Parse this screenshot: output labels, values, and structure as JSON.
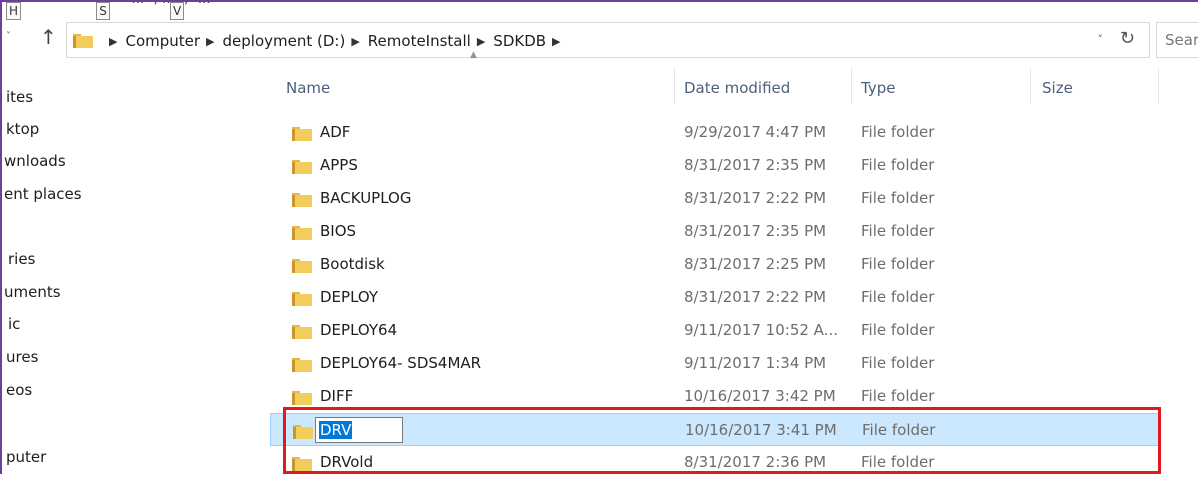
{
  "colors": {
    "frame": "#6b3fa0",
    "selection": "#cce8ff",
    "annotation": "#e0191c",
    "folder": "#dcb23f"
  },
  "ribbon": {
    "partial_text": "‹ … ›, … ›, ›…",
    "keytips": [
      "H",
      "S",
      "V"
    ]
  },
  "address_bar": {
    "back_glyph": "˅",
    "up_glyph": "↑",
    "crumbs": [
      "Computer",
      "deployment (D:)",
      "RemoteInstall",
      "SDKDB"
    ],
    "dropdown_glyph": "˅",
    "refresh_glyph": "↻"
  },
  "search": {
    "placeholder": "Searc"
  },
  "sidebar": {
    "items": [
      "ites",
      "ktop",
      "wnloads",
      "ent places",
      "ries",
      "uments",
      "ic",
      "ures",
      "eos",
      "puter"
    ]
  },
  "columns": {
    "name": "Name",
    "date_modified": "Date modified",
    "type": "Type",
    "size": "Size"
  },
  "rows": [
    {
      "name": "ADF",
      "date": "9/29/2017 4:47 PM",
      "type": "File folder"
    },
    {
      "name": "APPS",
      "date": "8/31/2017 2:35 PM",
      "type": "File folder"
    },
    {
      "name": "BACKUPLOG",
      "date": "8/31/2017 2:22 PM",
      "type": "File folder"
    },
    {
      "name": "BIOS",
      "date": "8/31/2017 2:35 PM",
      "type": "File folder"
    },
    {
      "name": "Bootdisk",
      "date": "8/31/2017 2:25 PM",
      "type": "File folder"
    },
    {
      "name": "DEPLOY",
      "date": "8/31/2017 2:22 PM",
      "type": "File folder"
    },
    {
      "name": "DEPLOY64",
      "date": "9/11/2017 10:52 A...",
      "type": "File folder"
    },
    {
      "name": "DEPLOY64- SDS4MAR",
      "date": "9/11/2017 1:34 PM",
      "type": "File folder"
    },
    {
      "name": "DIFF",
      "date": "10/16/2017 3:42 PM",
      "type": "File folder"
    },
    {
      "name": "DRV",
      "date": "10/16/2017 3:41 PM",
      "type": "File folder",
      "selected": true,
      "renaming": true
    },
    {
      "name": "DRVold",
      "date": "8/31/2017 2:36 PM",
      "type": "File folder"
    }
  ]
}
